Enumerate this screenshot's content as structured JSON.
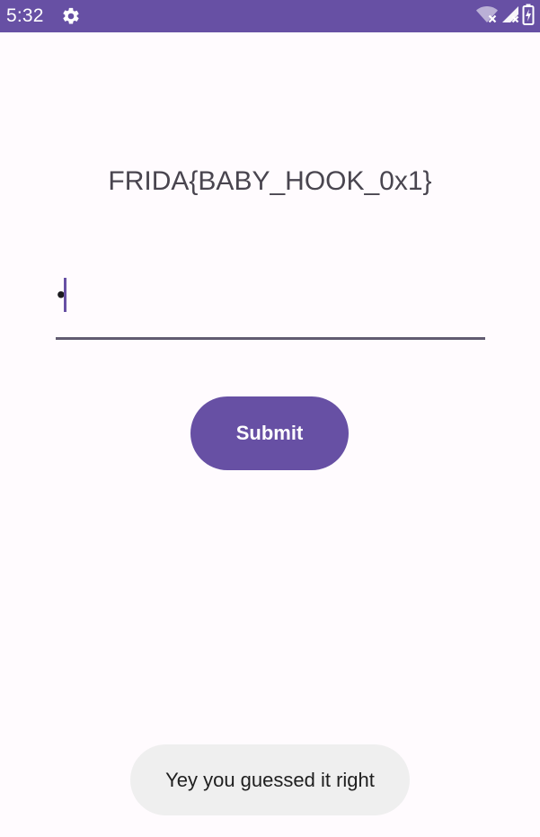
{
  "status_bar": {
    "time": "5:32",
    "left_icons": [
      "settings-icon"
    ],
    "right_icons": [
      "wifi-off-icon",
      "signal-off-icon",
      "battery-charging-icon"
    ],
    "background_color": "#6750a4"
  },
  "main": {
    "flag_text": "FRIDA{BABY_HOOK_0x1}",
    "input": {
      "value": "•",
      "placeholder": ""
    },
    "submit_label": "Submit"
  },
  "toast": {
    "message": "Yey you guessed it right"
  },
  "colors": {
    "primary": "#6750a4",
    "background": "#fffbfe",
    "text": "#49454f",
    "toast_background": "#efefef"
  }
}
